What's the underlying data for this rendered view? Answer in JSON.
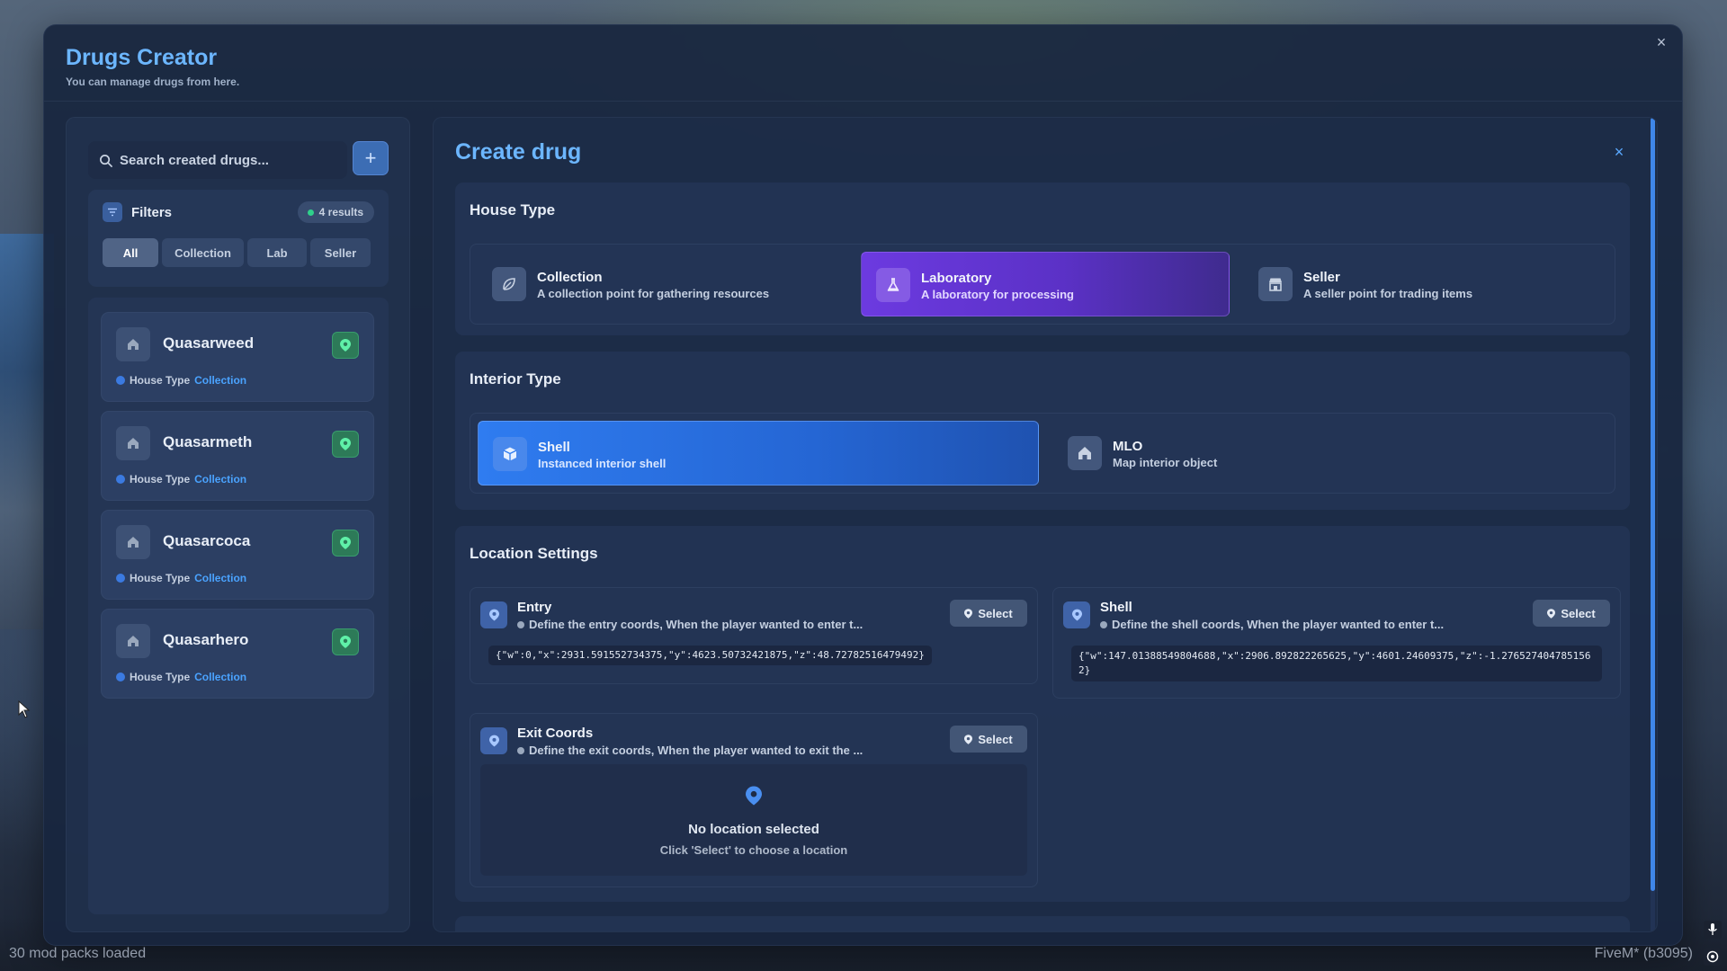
{
  "window": {
    "title": "Drugs Creator",
    "subtitle": "You can manage drugs from here.",
    "close_icon": "×"
  },
  "sidebar": {
    "search": {
      "placeholder": "Search created drugs...",
      "value": ""
    },
    "add_icon": "+",
    "filters": {
      "label": "Filters",
      "results": "4 results",
      "tabs": [
        {
          "label": "All",
          "active": true
        },
        {
          "label": "Collection",
          "active": false
        },
        {
          "label": "Lab",
          "active": false
        },
        {
          "label": "Seller",
          "active": false
        }
      ]
    },
    "drugs": [
      {
        "name": "Quasarweed",
        "type_label": "House Type",
        "type_value": "Collection"
      },
      {
        "name": "Quasarmeth",
        "type_label": "House Type",
        "type_value": "Collection"
      },
      {
        "name": "Quasarcoca",
        "type_label": "House Type",
        "type_value": "Collection"
      },
      {
        "name": "Quasarhero",
        "type_label": "House Type",
        "type_value": "Collection"
      }
    ]
  },
  "main": {
    "title": "Create drug",
    "close_icon": "×",
    "house_type": {
      "title": "House Type",
      "options": [
        {
          "label": "Collection",
          "desc": "A collection point for gathering resources",
          "icon": "leaf-icon",
          "selected": false
        },
        {
          "label": "Laboratory",
          "desc": "A laboratory for processing",
          "icon": "flask-icon",
          "selected": true
        },
        {
          "label": "Seller",
          "desc": "A seller point for trading items",
          "icon": "store-icon",
          "selected": false
        }
      ]
    },
    "interior_type": {
      "title": "Interior Type",
      "options": [
        {
          "label": "Shell",
          "desc": "Instanced interior shell",
          "icon": "cube-icon",
          "selected": true
        },
        {
          "label": "MLO",
          "desc": "Map interior object",
          "icon": "home-icon",
          "selected": false
        }
      ]
    },
    "location_settings": {
      "title": "Location Settings",
      "entry": {
        "title": "Entry",
        "desc": "Define the entry coords, When the player wanted to enter t...",
        "select_label": "Select",
        "coords": "{\"w\":0,\"x\":2931.591552734375,\"y\":4623.50732421875,\"z\":48.72782516479492}"
      },
      "shell": {
        "title": "Shell",
        "desc": "Define the shell coords, When the player wanted to enter t...",
        "select_label": "Select",
        "coords_line1": "{\"w\":147.01388549804688,\"x\":2906.892822265625,\"y\":4601.24609375,\"z\":-1.276527404785156",
        "coords_line2": "2}"
      },
      "exit": {
        "title": "Exit Coords",
        "desc": "Define the exit coords, When the player wanted to exit the ...",
        "select_label": "Select",
        "empty_title": "No location selected",
        "empty_sub": "Click 'Select' to choose a location"
      }
    }
  },
  "status_bar": {
    "left": "30 mod packs loaded",
    "right": "FiveM* (b3095)"
  },
  "colors": {
    "accent": "#6cb6ff",
    "lab_active": "#6c3ae0",
    "shell_active": "#2f7cf0",
    "pin_green": "#2d7a58",
    "link_blue": "#4aa3ff"
  }
}
